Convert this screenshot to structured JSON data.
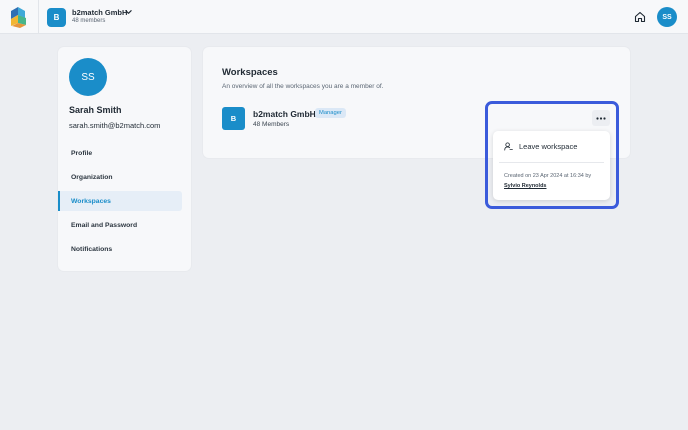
{
  "header": {
    "org_initial": "B",
    "org_name": "b2match GmbH",
    "org_members": "48 members",
    "user_initials": "SS",
    "icons": {
      "logo": "b2match-logo",
      "org_menu": "chevron-down-icon",
      "home": "home-icon"
    }
  },
  "profile": {
    "initials": "SS",
    "name": "Sarah Smith",
    "email": "sarah.smith@b2match.com"
  },
  "nav": {
    "items": [
      "Profile",
      "Organization",
      "Workspaces",
      "Email and Password",
      "Notifications"
    ],
    "active": "Workspaces"
  },
  "workspaces": {
    "title": "Workspaces",
    "subtitle": "An overview of all the workspaces you are a member of.",
    "items": [
      {
        "initial": "B",
        "name": "b2match GmbH",
        "role": "Manager",
        "members": "48 Members"
      }
    ]
  },
  "dropdown": {
    "leave_label": "Leave workspace",
    "created_text": "Created on 23 Apr 2024 at 16:34 by",
    "creator": "Sylvio Reynolds",
    "icons": {
      "more": "more-horizontal-icon",
      "leave": "user-remove-icon"
    }
  },
  "colors": {
    "accent": "#1a8dc9",
    "highlight": "#3b5bdb",
    "background": "#eceef2",
    "card": "#f7f8fa",
    "role_badge_bg": "#dbe8f6"
  }
}
